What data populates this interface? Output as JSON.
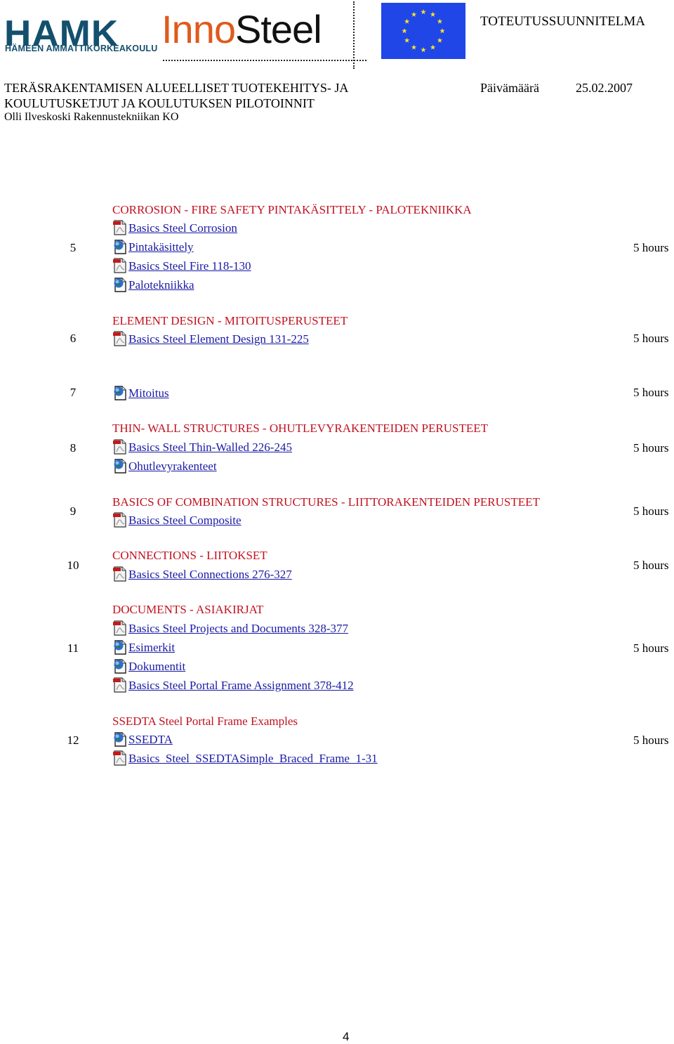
{
  "header": {
    "logo_hamk": "HAMK",
    "logo_hamk_sub": "HÄMEEN AMMATTIKORKEAKOULU",
    "logo_inno_a": "Inno",
    "logo_inno_b": "Steel",
    "document_type": "TOTEUTUSSUUNNITELMA",
    "title_line1": "TERÄSRAKENTAMISEN ALUEELLISET TUOTEKEHITYS- JA",
    "title_line2": "KOULUTUSKETJUT JA KOULUTUKSEN PILOTOINNIT",
    "author_line": "Olli Ilveskoski  Rakennustekniikan KO",
    "date_label": "Päivämäärä",
    "date_value": "25.02.2007"
  },
  "colors": {
    "heading": "#c0111f",
    "link": "#1a1aa6",
    "hamk_blue": "#14506e",
    "inno_orange": "#e05a1c",
    "eu_blue": "#2046e8",
    "eu_star": "#f5e32a"
  },
  "rows": [
    {
      "number": "5",
      "hours": "5 hours",
      "heading": "CORROSION - FIRE SAFETY  PINTAKÄSITTELY - PALOTEKNIIKKA",
      "links": [
        {
          "icon": "pdf-icon",
          "label": "Basics Steel Corrosion"
        },
        {
          "icon": "web-page-icon",
          "label": "Pintakäsittely"
        },
        {
          "icon": "pdf-icon",
          "label": "Basics Steel Fire 118-130"
        },
        {
          "icon": "web-page-icon",
          "label": "Palotekniikka"
        }
      ]
    },
    {
      "number": "6",
      "hours": "5 hours",
      "heading": "ELEMENT DESIGN - MITOITUSPERUSTEET",
      "links": [
        {
          "icon": "pdf-icon",
          "label": "Basics Steel Element Design 131-225"
        }
      ]
    },
    {
      "number": "7",
      "hours": "5 hours",
      "heading": "",
      "links": [
        {
          "icon": "web-page-icon",
          "label": "Mitoitus"
        }
      ]
    },
    {
      "number": "8",
      "hours": "5 hours",
      "heading": "THIN- WALL STRUCTURES - OHUTLEVYRAKENTEIDEN PERUSTEET",
      "links": [
        {
          "icon": "pdf-icon",
          "label": "Basics Steel Thin-Walled 226-245"
        },
        {
          "icon": "web-page-icon",
          "label": "Ohutlevyrakenteet"
        }
      ]
    },
    {
      "number": "9",
      "hours": "5 hours",
      "heading": "BASICS OF COMBINATION STRUCTURES -  LIITTORAKENTEIDEN PERUSTEET",
      "links": [
        {
          "icon": "pdf-icon",
          "label": "Basics Steel Composite"
        }
      ]
    },
    {
      "number": "10",
      "hours": "5 hours",
      "heading": "CONNECTIONS - LIITOKSET",
      "links": [
        {
          "icon": "pdf-icon",
          "label": "Basics Steel Connections 276-327"
        }
      ]
    },
    {
      "number": "11",
      "hours": "5 hours",
      "heading": "DOCUMENTS - ASIAKIRJAT",
      "links": [
        {
          "icon": "pdf-icon",
          "label": "Basics Steel Projects and Documents 328-377"
        },
        {
          "icon": "web-page-icon",
          "label": "Esimerkit"
        },
        {
          "icon": "web-page-icon",
          "label": "Dokumentit"
        },
        {
          "icon": "pdf-icon",
          "label": "Basics Steel Portal Frame Assignment 378-412"
        }
      ]
    },
    {
      "number": "12",
      "hours": "5 hours",
      "heading": "SSEDTA   Steel Portal Frame Examples",
      "links": [
        {
          "icon": "web-page-icon",
          "label": "SSEDTA"
        },
        {
          "icon": "pdf-icon",
          "label": "Basics_Steel_SSEDTASimple_Braced_Frame_1-31"
        }
      ]
    }
  ],
  "footer": {
    "page_number": "4"
  }
}
